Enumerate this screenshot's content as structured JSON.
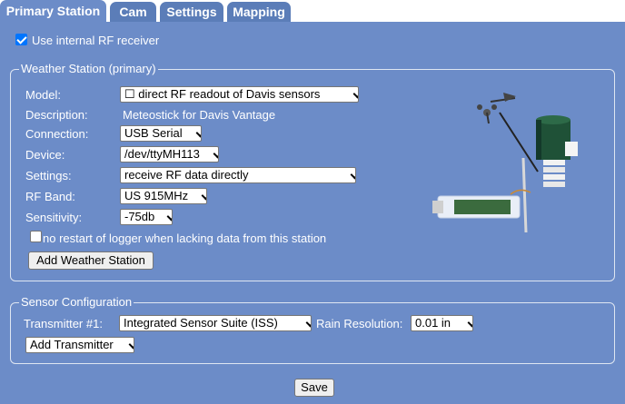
{
  "tabs": [
    {
      "label": "Primary Station",
      "active": true
    },
    {
      "label": "Cam",
      "active": false
    },
    {
      "label": "Settings",
      "active": false
    },
    {
      "label": "Mapping",
      "active": false
    }
  ],
  "use_internal_rf": {
    "label": "Use internal RF receiver",
    "checked": true
  },
  "weather_station": {
    "legend": "Weather Station (primary)",
    "model_label": "Model:",
    "model_value": "☐ direct RF readout of Davis sensors",
    "description_label": "Description:",
    "description_value": "Meteostick for Davis Vantage",
    "connection_label": "Connection:",
    "connection_value": "USB Serial",
    "device_label": "Device:",
    "device_value": "/dev/ttyMH113",
    "settings_label": "Settings:",
    "settings_value": "receive RF data directly",
    "rfband_label": "RF Band:",
    "rfband_value": "US 915MHz",
    "sensitivity_label": "Sensitivity:",
    "sensitivity_value": "-75db",
    "no_restart_label": "no restart of logger when lacking data from this station",
    "no_restart_checked": false,
    "add_button": "Add Weather Station"
  },
  "sensor_config": {
    "legend": "Sensor Configuration",
    "transmitter_label": "Transmitter #1:",
    "transmitter_value": "Integrated Sensor Suite (ISS)",
    "rain_label": "Rain Resolution:",
    "rain_value": "0.01 in",
    "add_transmitter": "Add Transmitter"
  },
  "save_button": "Save",
  "colors": {
    "background": "#6c8cc8",
    "tab": "#5b7db8",
    "checkbox_accent": "#0075ff"
  }
}
